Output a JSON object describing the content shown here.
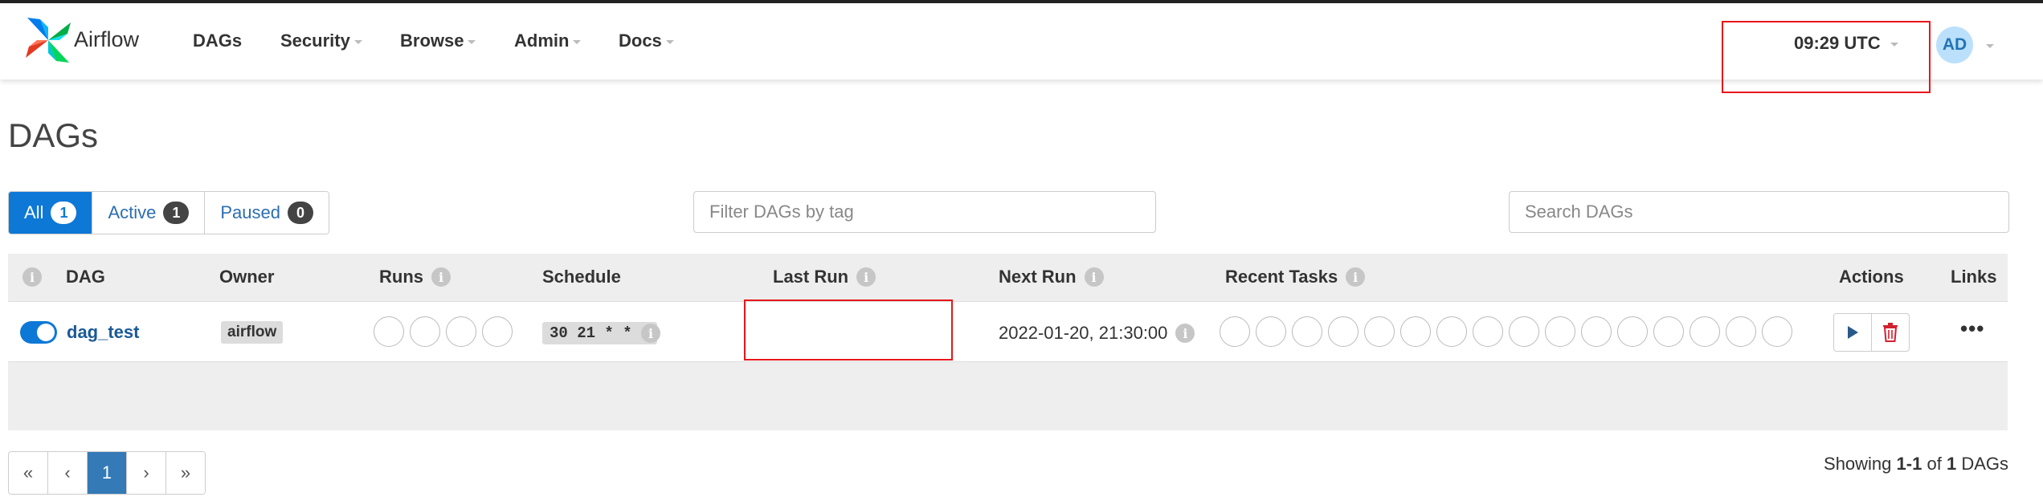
{
  "app": {
    "name": "Airflow"
  },
  "nav": {
    "items": [
      {
        "label": "DAGs",
        "has_caret": false
      },
      {
        "label": "Security",
        "has_caret": true
      },
      {
        "label": "Browse",
        "has_caret": true
      },
      {
        "label": "Admin",
        "has_caret": true
      },
      {
        "label": "Docs",
        "has_caret": true
      }
    ],
    "clock": "09:29 UTC",
    "avatar_initials": "AD"
  },
  "page": {
    "title": "DAGs"
  },
  "filters": {
    "status": [
      {
        "label": "All",
        "count": "1",
        "active": true
      },
      {
        "label": "Active",
        "count": "1",
        "active": false
      },
      {
        "label": "Paused",
        "count": "0",
        "active": false
      }
    ],
    "tag_placeholder": "Filter DAGs by tag",
    "search_placeholder": "Search DAGs"
  },
  "table": {
    "headers": {
      "dag": "DAG",
      "owner": "Owner",
      "runs": "Runs",
      "schedule": "Schedule",
      "last_run": "Last Run",
      "next_run": "Next Run",
      "recent_tasks": "Recent Tasks",
      "actions": "Actions",
      "links": "Links"
    },
    "rows": [
      {
        "paused": false,
        "dag_id": "dag_test",
        "owner": "airflow",
        "schedule": "30 21 * * *",
        "last_run": "",
        "next_run": "2022-01-20, 21:30:00",
        "links_label": "•••"
      }
    ]
  },
  "pagination": {
    "first": "«",
    "prev": "‹",
    "current": "1",
    "next": "›",
    "last": "»"
  },
  "summary": {
    "prefix": "Showing",
    "range": "1-1",
    "of": "of",
    "total": "1",
    "suffix": "DAGs"
  },
  "colors": {
    "primary": "#0e78d7",
    "link": "#1a5a96",
    "highlight_box": "#e8161b",
    "delete": "#d3202f"
  },
  "icons": {
    "logo": "airflow-pinwheel-icon",
    "info": "info-icon",
    "trigger": "play-icon",
    "delete": "trash-icon",
    "links": "ellipsis-icon"
  }
}
